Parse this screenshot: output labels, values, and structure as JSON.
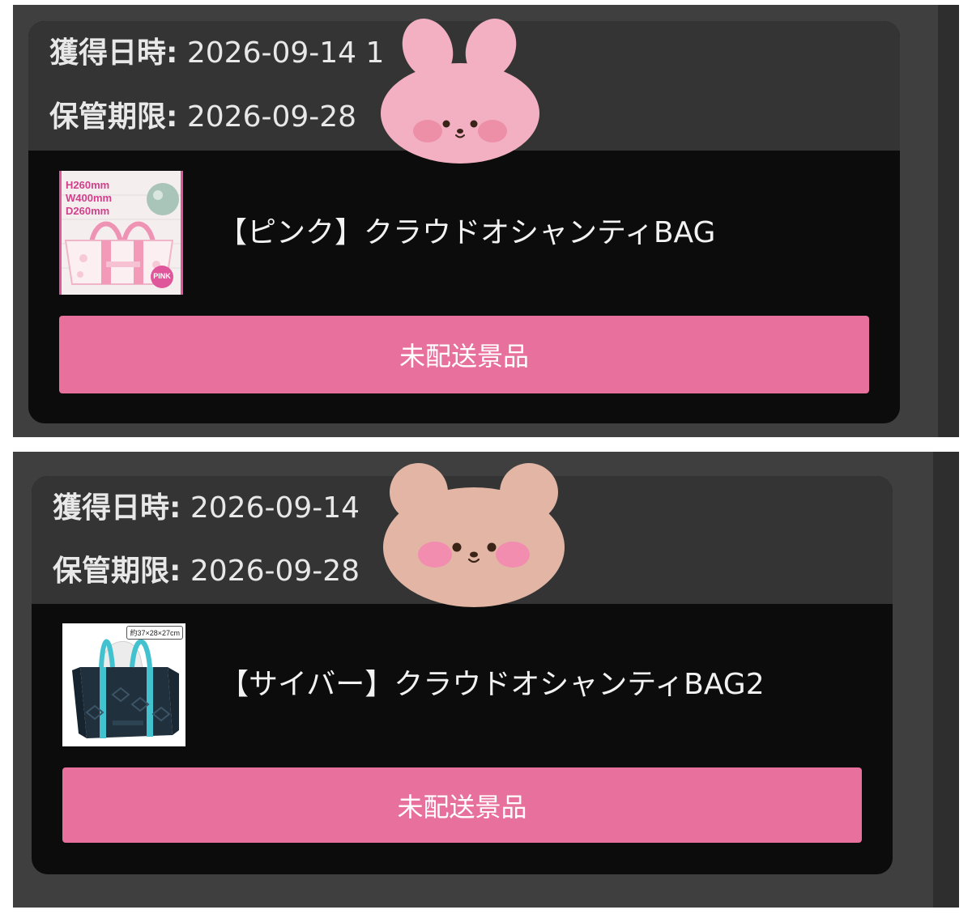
{
  "items": [
    {
      "acquired_label": "獲得日時:",
      "acquired_value": "2026-09-14 1",
      "expiry_label": "保管期限:",
      "expiry_value": "2026-09-28",
      "product_name": "【ピンク】クラウドオシャンティBAG",
      "thumb_lines": [
        "H260mm",
        "W400mm",
        "D260mm"
      ],
      "thumb_badge": "PINK",
      "button_label": "未配送景品"
    },
    {
      "acquired_label": "獲得日時:",
      "acquired_value": "2026-09-14",
      "expiry_label": "保管期限:",
      "expiry_value": "2026-09-28",
      "product_name": "【サイバー】クラウドオシャンティBAG2",
      "thumb_size_label": "約37×28×27cm",
      "button_label": "未配送景品"
    }
  ],
  "colors": {
    "panel_bg": "#3f3f3f",
    "card_header": "#343434",
    "card_body": "#0c0c0c",
    "button": "#e8709c",
    "bunny_sticker": "#f2b0c2",
    "bear_sticker": "#e2b5a4"
  },
  "stickers": [
    "bunny-face-sticker",
    "bear-face-sticker"
  ]
}
